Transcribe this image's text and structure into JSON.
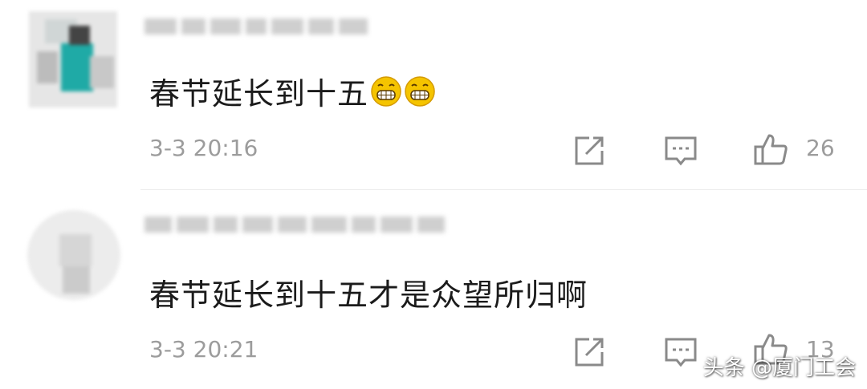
{
  "comments": [
    {
      "text": "春节延长到十五",
      "emoji": [
        "grinning-teeth",
        "grinning-teeth"
      ],
      "time": "3-3 20:16",
      "likes": "26"
    },
    {
      "text": "春节延长到十五才是众望所归啊",
      "time": "3-3 20:21",
      "likes": "13"
    }
  ],
  "icons": {
    "share": "share-icon",
    "reply": "comment-reply-icon",
    "like": "thumbs-up-icon"
  },
  "watermark": "头条 @厦门工会",
  "colors": {
    "text": "#1b1b1b",
    "meta": "#9c9c9c",
    "emoji": "#f5c400"
  }
}
